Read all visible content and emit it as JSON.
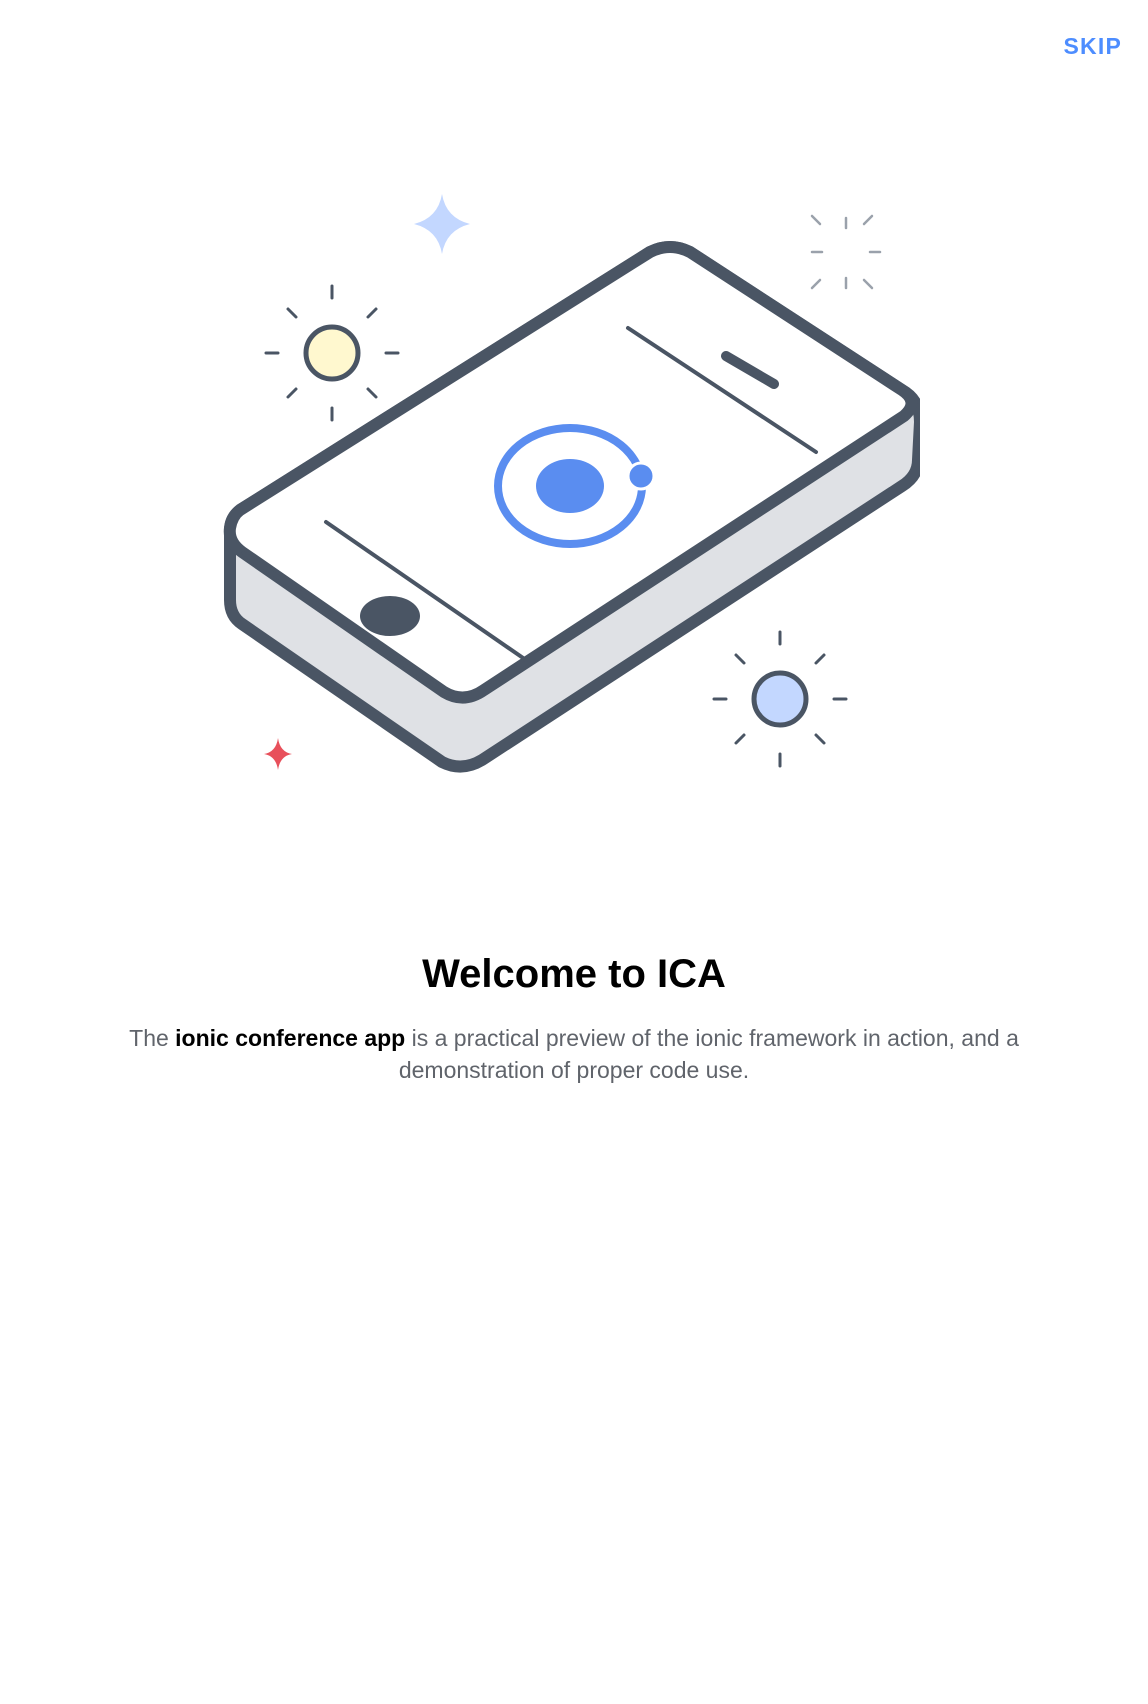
{
  "header": {
    "skip_label": "SKIP"
  },
  "slide": {
    "title": "Welcome to ICA",
    "description": {
      "prefix": "The ",
      "highlight": "ionic conference app",
      "suffix": " is a practical preview of the ionic framework in action, and a demonstration of proper code use."
    }
  },
  "illustration": {
    "icon": "phone-with-ionic-logo-illustration"
  },
  "colors": {
    "accent": "#4d8dff",
    "phone_outline": "#4a5564",
    "logo_blue": "#5a8df0",
    "sparkle_light_blue": "#c3d7ff",
    "sun_yellow": "#fff8cf",
    "star_red": "#e8505b"
  }
}
